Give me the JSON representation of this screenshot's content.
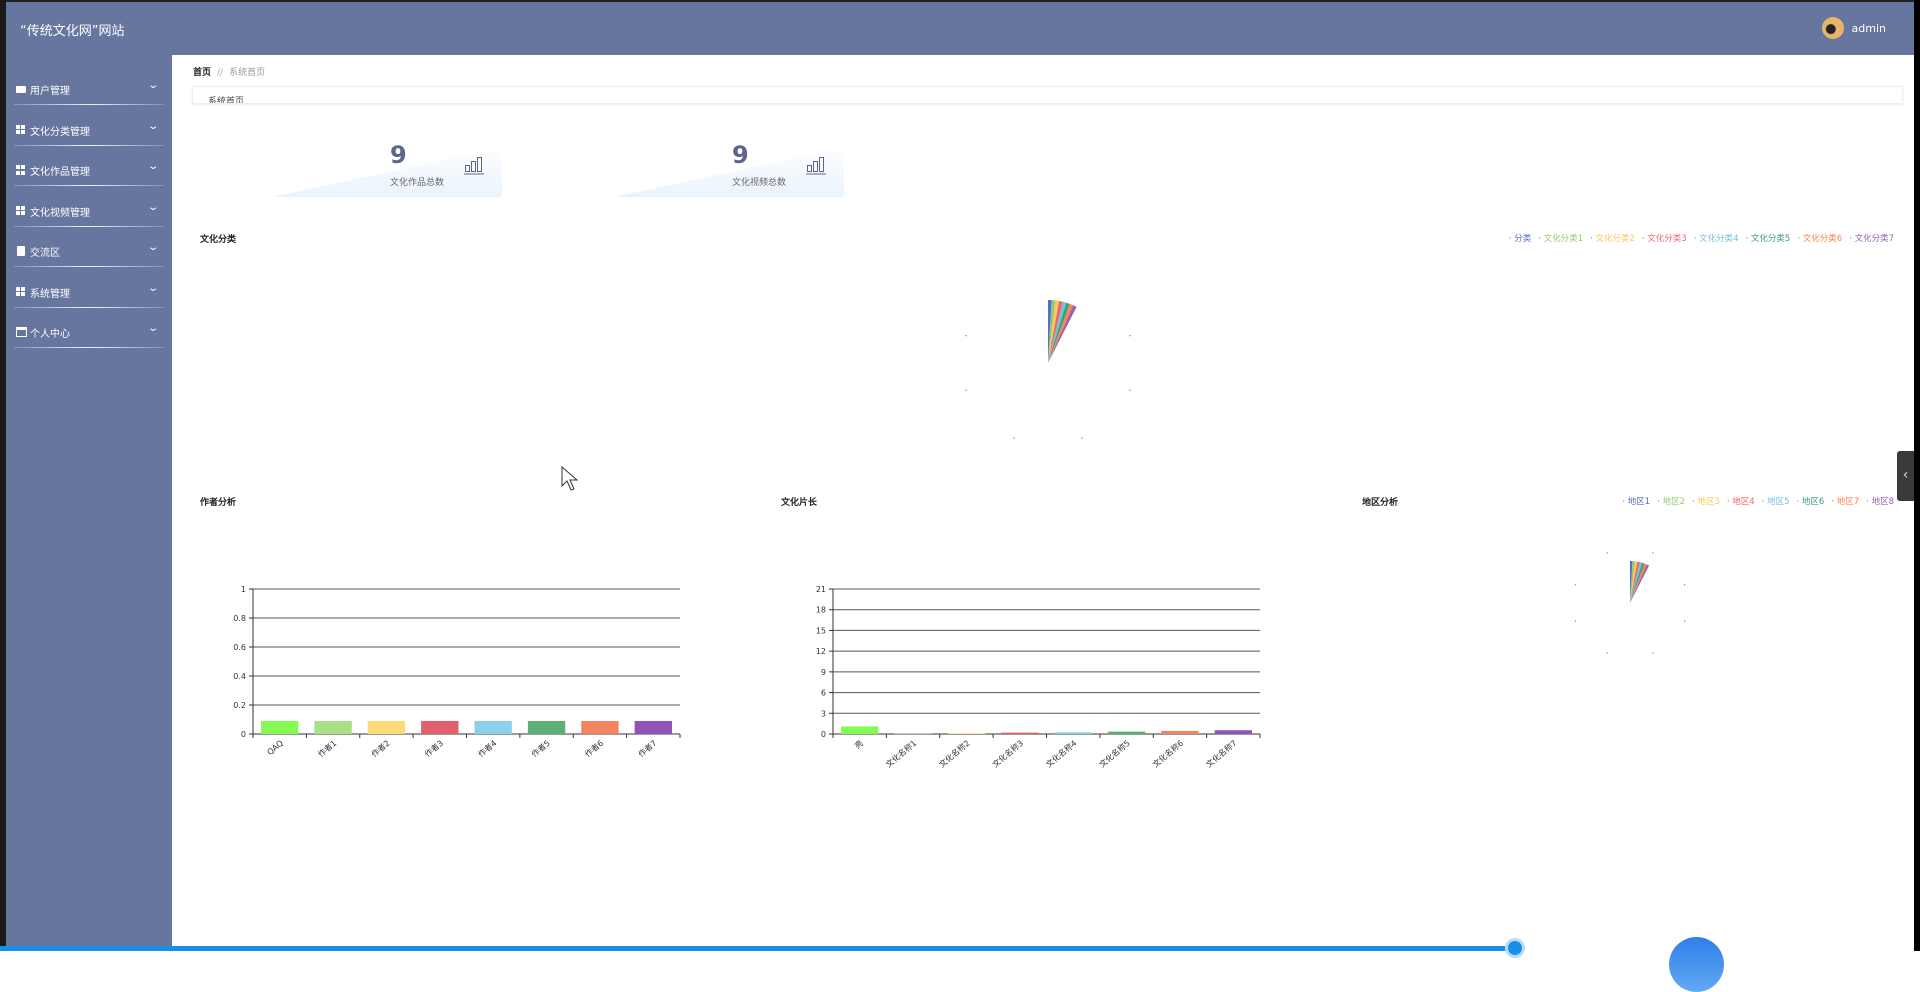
{
  "header": {
    "title": "“传统文化网”网站",
    "username": "admin"
  },
  "sidebar": {
    "items": [
      {
        "label": "用户管理",
        "icon": "user-card-icon"
      },
      {
        "label": "文化分类管理",
        "icon": "grid-icon"
      },
      {
        "label": "文化作品管理",
        "icon": "grid-icon"
      },
      {
        "label": "文化视频管理",
        "icon": "grid-icon"
      },
      {
        "label": "交流区",
        "icon": "clipboard-icon"
      },
      {
        "label": "系统管理",
        "icon": "grid-icon"
      },
      {
        "label": "个人中心",
        "icon": "wallet-icon"
      }
    ]
  },
  "breadcrumb": {
    "home": "首页",
    "separator": "//",
    "current": "系统首页"
  },
  "tab": {
    "label": "系统首页"
  },
  "stats": [
    {
      "value": "9",
      "label": "文化作品总数",
      "icon": "bar-chart-icon"
    },
    {
      "value": "9",
      "label": "文化视频总数",
      "icon": "bar-chart-icon"
    }
  ],
  "colors": {
    "header": "#67769f",
    "sidebar": "#67769f",
    "accent": "#1a8fe8"
  },
  "chart_data": [
    {
      "id": "category",
      "type": "pie",
      "title": "文化分类",
      "rose": true,
      "legend_position": "top-right",
      "categories": [
        "分类",
        "文化分类1",
        "文化分类2",
        "文化分类3",
        "文化分类4",
        "文化分类5",
        "文化分类6",
        "文化分类7"
      ],
      "colors": [
        "#5470c6",
        "#91cc75",
        "#fac858",
        "#ee6666",
        "#73c0de",
        "#3ba272",
        "#fc8452",
        "#9a60b4"
      ],
      "values": [
        1,
        1,
        1,
        1,
        1,
        1,
        1,
        1
      ]
    },
    {
      "id": "author",
      "type": "bar",
      "title": "作者分析",
      "ylim": [
        0,
        1
      ],
      "yticks": [
        "0",
        "0.2",
        "0.4",
        "0.6",
        "0.8",
        "1"
      ],
      "grid": true,
      "categories": [
        "QAQ",
        "作者1",
        "作者2",
        "作者3",
        "作者4",
        "作者5",
        "作者6",
        "作者7"
      ],
      "values": [
        0.09,
        0.09,
        0.09,
        0.09,
        0.09,
        0.09,
        0.09,
        0.09
      ],
      "colors": [
        "#85f956",
        "#a9df86",
        "#fddb76",
        "#e0606e",
        "#8ecfea",
        "#5daf78",
        "#f2855f",
        "#8f55b5"
      ]
    },
    {
      "id": "length",
      "type": "bar",
      "title": "文化片长",
      "ylim": [
        0,
        21
      ],
      "yticks": [
        "0",
        "3",
        "6",
        "9",
        "12",
        "15",
        "18",
        "21"
      ],
      "grid": true,
      "categories": [
        "亮",
        "文化名称1",
        "文化名称2",
        "文化名称3",
        "文化名称4",
        "文化名称5",
        "文化名称6",
        "文化名称7"
      ],
      "values": [
        1.1,
        0.05,
        0.1,
        0.2,
        0.25,
        0.35,
        0.45,
        0.55
      ],
      "colors": [
        "#85f956",
        "#a9df86",
        "#fddb76",
        "#e0606e",
        "#8ecfea",
        "#5daf78",
        "#f2855f",
        "#8f55b5"
      ]
    },
    {
      "id": "region",
      "type": "pie",
      "title": "地区分析",
      "rose": true,
      "legend_position": "top-right",
      "categories": [
        "地区1",
        "地区2",
        "地区3",
        "地区4",
        "地区5",
        "地区6",
        "地区7",
        "地区8"
      ],
      "colors": [
        "#5470c6",
        "#91cc75",
        "#fac858",
        "#ee6666",
        "#73c0de",
        "#3ba272",
        "#fc8452",
        "#9a60b4"
      ],
      "values": [
        1,
        1,
        1,
        1,
        1,
        1,
        1,
        1
      ]
    }
  ]
}
